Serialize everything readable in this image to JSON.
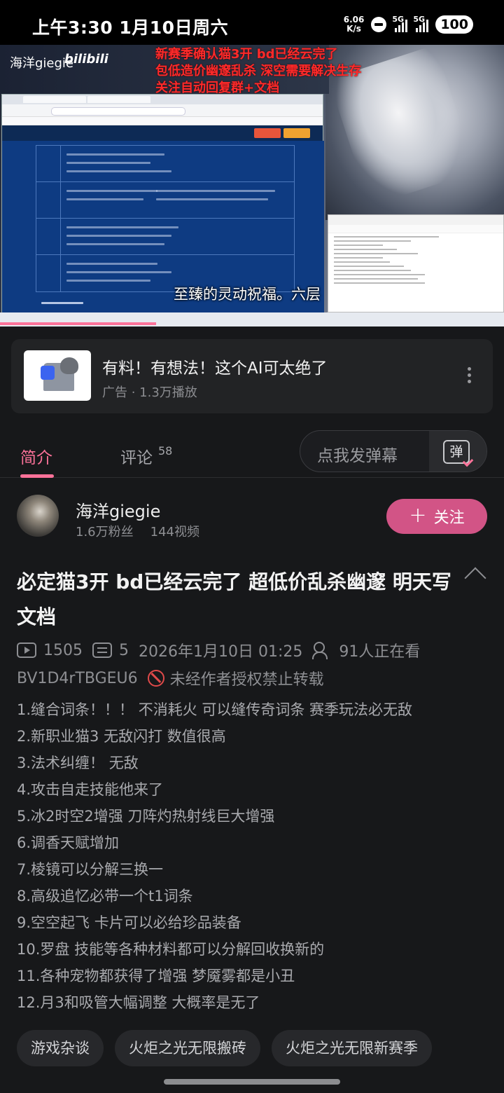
{
  "status_bar": {
    "time": "上午3:30  1月10日周六",
    "net_speed_value": "6.06",
    "net_speed_unit": "K/s",
    "signal_1": "5G",
    "signal_2": "5G",
    "battery": "100"
  },
  "video": {
    "uploader_watermark": "海洋giegie",
    "platform_watermark": "bilibili",
    "overlay_lines": [
      "新赛季确认猫3开  bd已经云完了",
      "包低造价幽邃乱杀  深空需要解决生存",
      "关注自动回复群+文档"
    ],
    "subtitle": "至臻的灵动祝福。六层",
    "progress_fraction": 0.31
  },
  "ad": {
    "title": "有料！有想法！这个AI可太绝了",
    "subtitle": "广告 · 1.3万播放"
  },
  "tabs": {
    "intro": "简介",
    "comments": "评论",
    "comments_count": "58",
    "danmaku_placeholder": "点我发弹幕",
    "danmaku_icon_label": "弹"
  },
  "author": {
    "name": "海洋giegie",
    "fans": "1.6万粉丝",
    "videos": "144视频",
    "follow_label": "关注"
  },
  "video_info": {
    "title": "必定猫3开 bd已经云完了 超低价乱杀幽邃 明天写文档",
    "views": "1505",
    "danmaku_count": "5",
    "date": "2026年1月10日 01:25",
    "watching": "91人正在看",
    "bvid": "BV1D4rTBGEU6",
    "copyright": "未经作者授权禁止转载"
  },
  "description": [
    "1.缝合词条！！！ 不消耗火  可以缝传奇词条 赛季玩法必无敌",
    "2.新职业猫3 无敌闪打 数值很高",
    "3.法术纠缠！ 无敌",
    "4.攻击自走技能他来了",
    "5.冰2时空2增强 刀阵灼热射线巨大增强",
    "6.调香天赋增加",
    "7.棱镜可以分解三换一",
    "8.高级追忆必带一个t1词条",
    "9.空空起飞 卡片可以必给珍品装备",
    "10.罗盘 技能等各种材料都可以分解回收换新的",
    "11.各种宠物都获得了增强 梦魇雾都是小丑",
    "12.月3和吸管大幅调整  大概率是无了"
  ],
  "tags": [
    "游戏杂谈",
    "火炬之光无限搬砖",
    "火炬之光无限新赛季"
  ],
  "colors": {
    "accent": "#fb7299",
    "follow_button": "#d25486",
    "background": "#17181a",
    "overlay_text": "#ff2a2a"
  }
}
